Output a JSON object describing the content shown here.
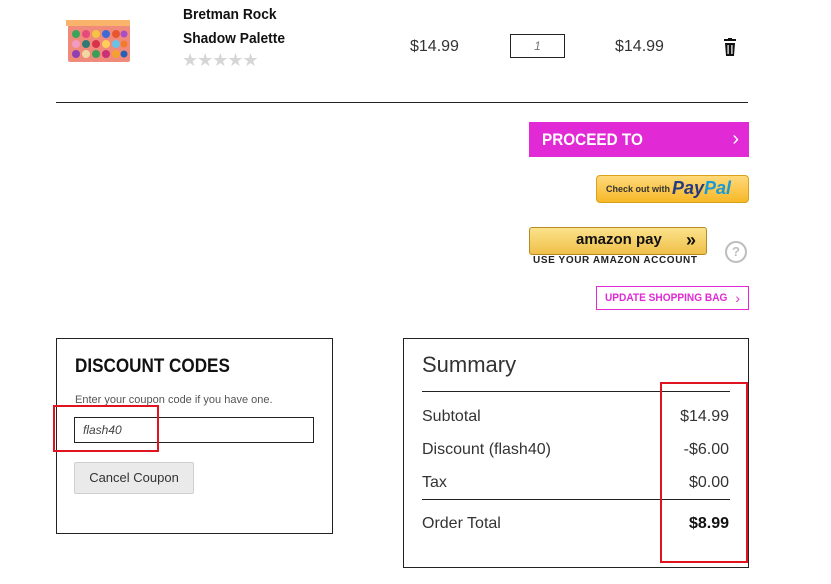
{
  "product": {
    "name": "Bretman Rock Shadow Palette",
    "rating_stars": "★★★★★",
    "price": "$14.99",
    "quantity": "1",
    "row_total": "$14.99"
  },
  "actions": {
    "checkout_label": "PROCEED TO CHECKOUT",
    "checkout_chevron": "›",
    "paypal_prefix": "Check out with",
    "paypal_logo_a": "Pay",
    "paypal_logo_b": "Pal",
    "amazon_logo": "amazon pay",
    "amazon_arrows": "»",
    "amazon_sub": "USE YOUR AMAZON ACCOUNT",
    "help_glyph": "?",
    "update_label": "UPDATE SHOPPING BAG",
    "update_chevron": "›"
  },
  "discount": {
    "title": "DISCOUNT CODES",
    "help_text": "Enter your coupon code if you have one.",
    "coupon_value": "flash40",
    "cancel_label": "Cancel Coupon"
  },
  "summary": {
    "title": "Summary",
    "subtotal_label": "Subtotal",
    "subtotal_value": "$14.99",
    "discount_label": "Discount (flash40)",
    "discount_value": "-$6.00",
    "tax_label": "Tax",
    "tax_value": "$0.00",
    "total_label": "Order Total",
    "total_value": "$8.99"
  },
  "colors": {
    "accent": "#e12ad5",
    "highlight": "#e0141e"
  },
  "icons": {
    "trash": "trash-icon",
    "chevron": "chevron-right-icon",
    "help": "help-circle-icon"
  }
}
